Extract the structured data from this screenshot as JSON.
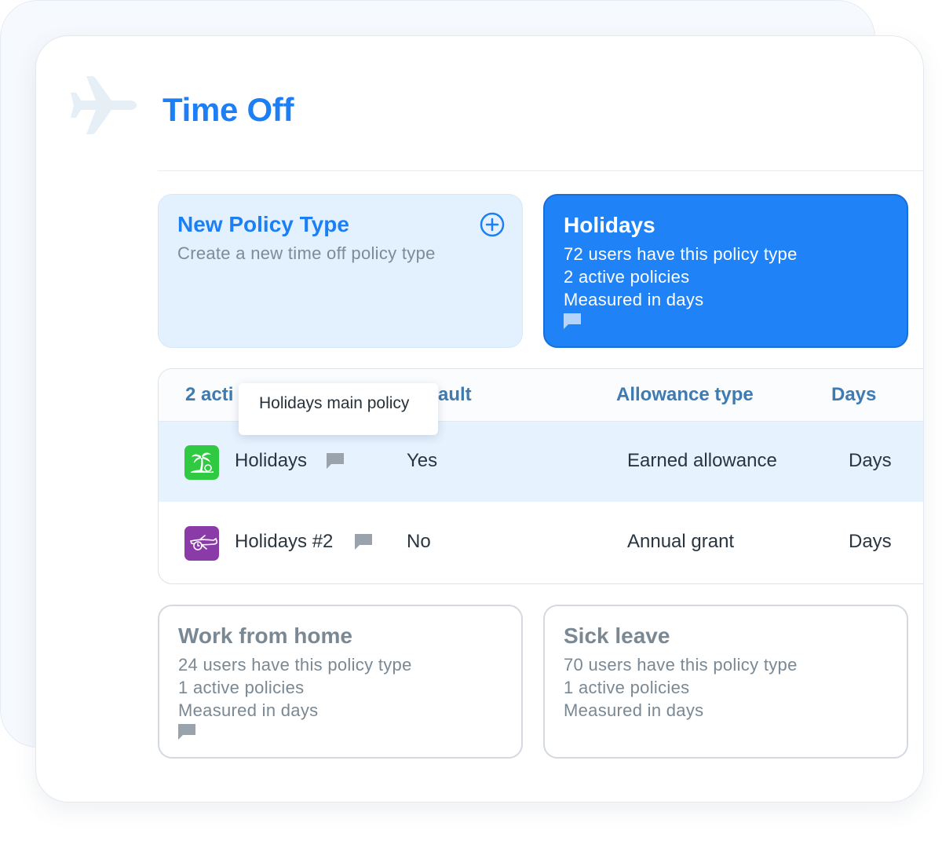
{
  "page": {
    "title": "Time Off",
    "header_icon": "airplane-icon"
  },
  "colors": {
    "accent": "#1c7ff5",
    "selected_card": "#1f83f7",
    "new_card_bg": "#e2f1fd",
    "row_selected_bg": "#e6f2fe",
    "holidays_icon_bg": "#2fc942",
    "holidays2_icon_bg": "#8b3ba8"
  },
  "cards": {
    "new_policy": {
      "title": "New Policy Type",
      "subtitle": "Create a new time off policy type",
      "icon": "plus-circle-icon"
    },
    "holidays": {
      "title": "Holidays",
      "users": "72 users have this policy type",
      "policies": "2 active policies",
      "measured": "Measured in days",
      "icon": "comment-icon"
    },
    "work_from_home": {
      "title": "Work from home",
      "users": "24 users have this policy type",
      "policies": "1 active policies",
      "measured": "Measured in days",
      "icon": "comment-icon"
    },
    "sick_leave": {
      "title": "Sick leave",
      "users": "70 users have this policy type",
      "policies": "1 active policies",
      "measured": "Measured in days"
    }
  },
  "table": {
    "headers": [
      "2 acti",
      "ault",
      "Allowance type",
      "Days"
    ],
    "rows": [
      {
        "name": "Holidays",
        "default": "Yes",
        "allowance_type": "Earned allowance",
        "unit": "Days",
        "icon": "palm-tree-icon",
        "selected": true
      },
      {
        "name": "Holidays #2",
        "default": "No",
        "allowance_type": "Annual grant",
        "unit": "Days",
        "icon": "airplane-clock-icon",
        "selected": false
      }
    ]
  },
  "tooltip": {
    "text": "Holidays main policy"
  }
}
